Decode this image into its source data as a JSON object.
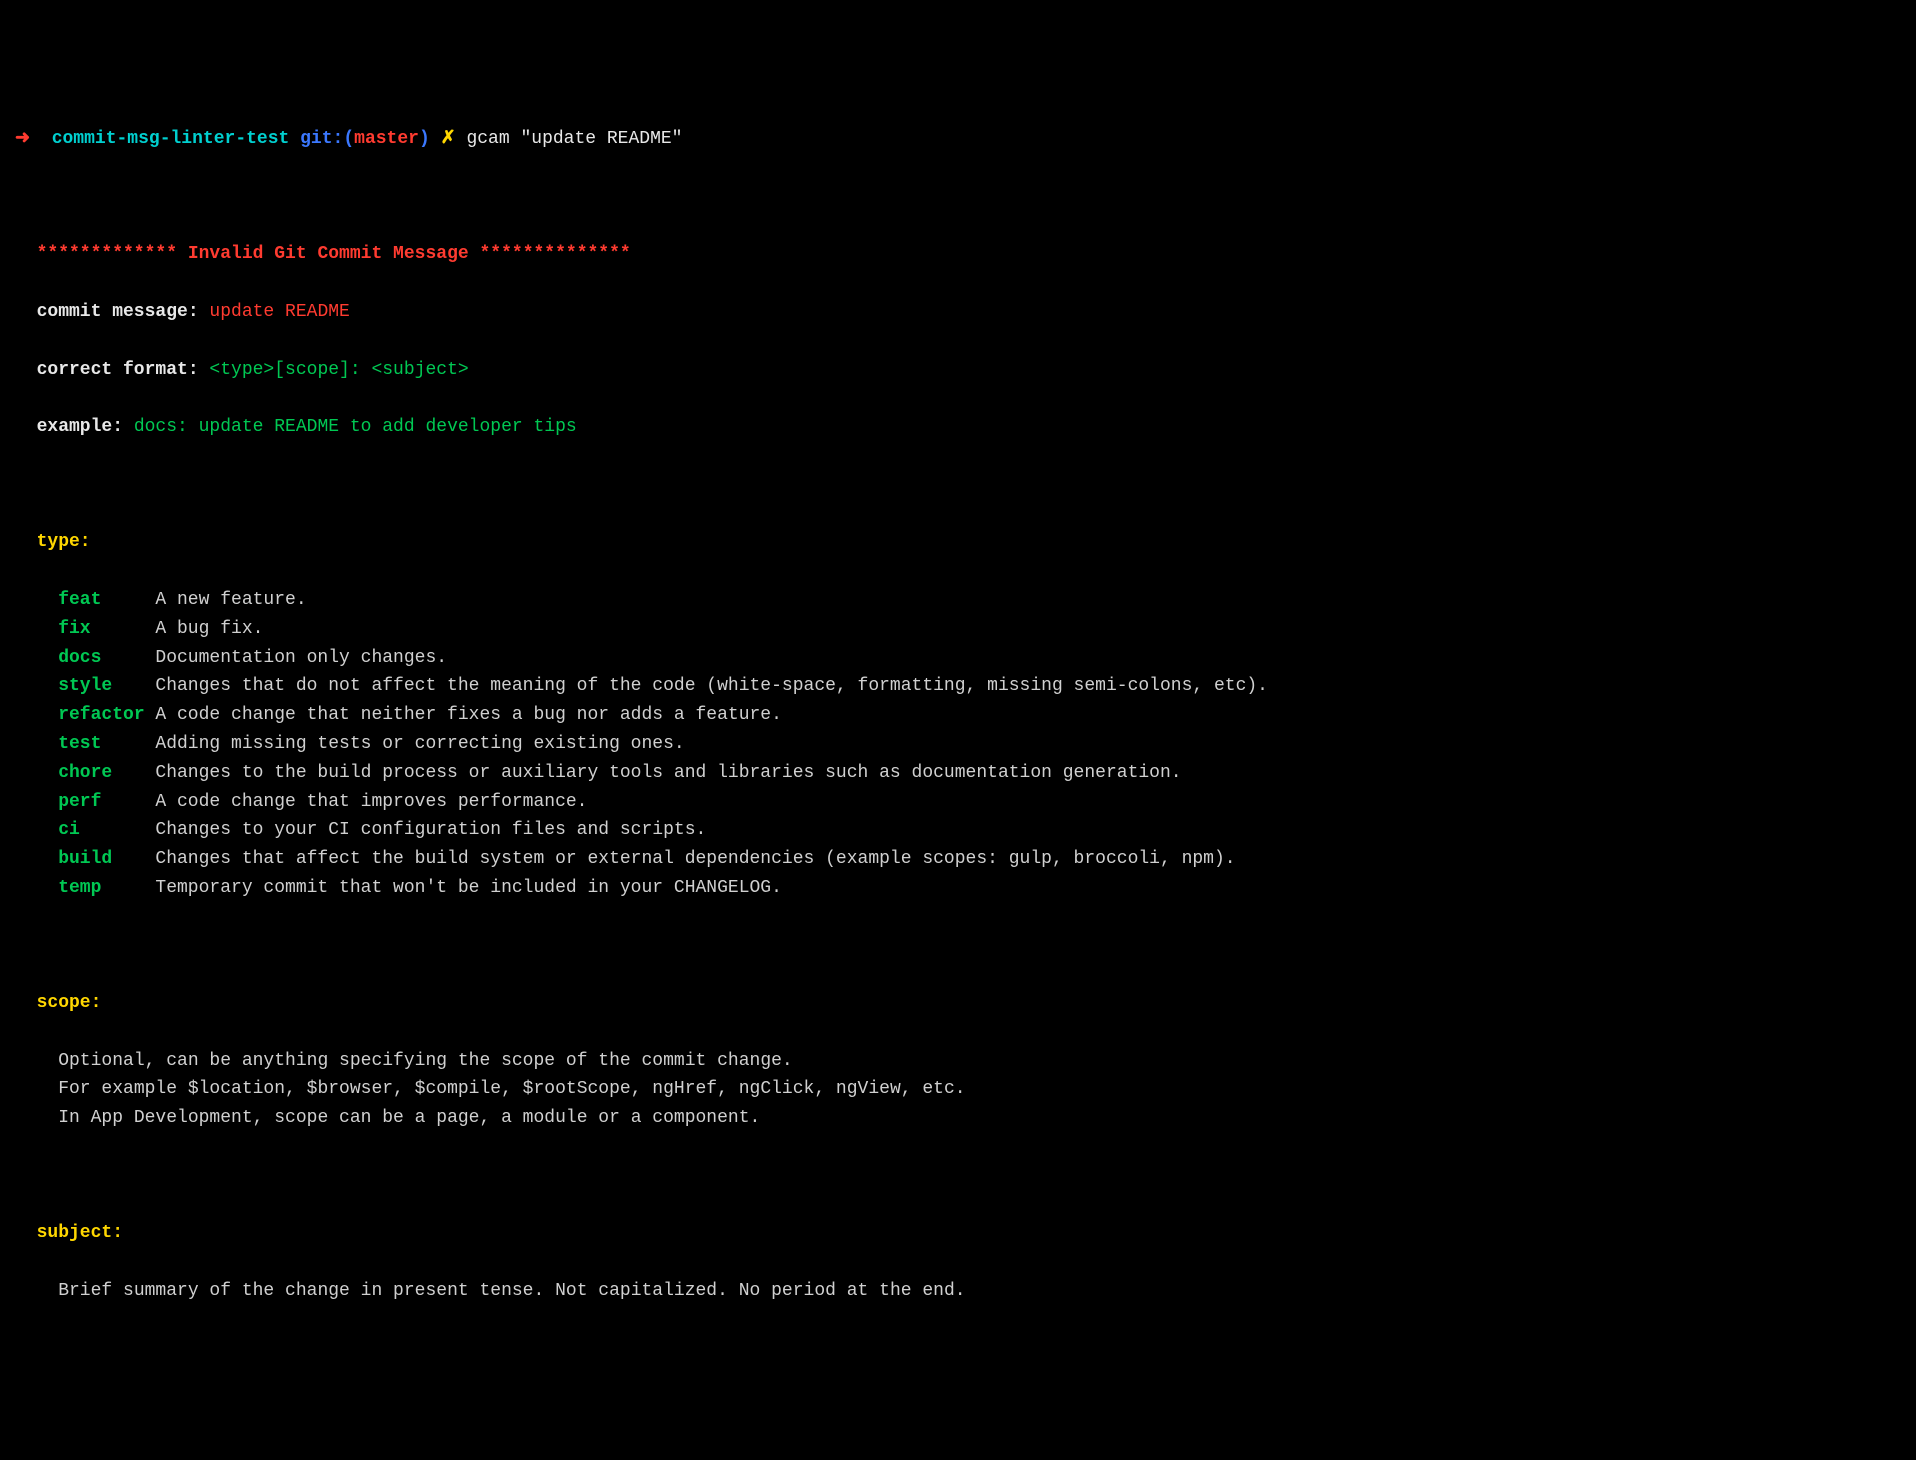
{
  "prompt": {
    "arrow": "➜  ",
    "dir": "commit-msg-linter-test",
    "git_label": " git:(",
    "branch": "master",
    "git_close": ")",
    "dirty": " ✗ ",
    "command": "gcam \"update README\""
  },
  "error": {
    "prefix": "************* ",
    "title": "Invalid Git Commit Message",
    "suffix": " **************"
  },
  "msg": {
    "label": "commit message:",
    "value": " update README"
  },
  "format": {
    "label": "correct format:",
    "value": " <type>[scope]: <subject>"
  },
  "example": {
    "label": "example:",
    "value": " docs: update README to add developer tips"
  },
  "type_header": "type:",
  "types": [
    {
      "key": "feat",
      "desc": "A new feature."
    },
    {
      "key": "fix",
      "desc": "A bug fix."
    },
    {
      "key": "docs",
      "desc": "Documentation only changes."
    },
    {
      "key": "style",
      "desc": "Changes that do not affect the meaning of the code (white-space, formatting, missing semi-colons, etc)."
    },
    {
      "key": "refactor",
      "desc": "A code change that neither fixes a bug nor adds a feature."
    },
    {
      "key": "test",
      "desc": "Adding missing tests or correcting existing ones."
    },
    {
      "key": "chore",
      "desc": "Changes to the build process or auxiliary tools and libraries such as documentation generation."
    },
    {
      "key": "perf",
      "desc": "A code change that improves performance."
    },
    {
      "key": "ci",
      "desc": "Changes to your CI configuration files and scripts."
    },
    {
      "key": "build",
      "desc": "Changes that affect the build system or external dependencies (example scopes: gulp, broccoli, npm)."
    },
    {
      "key": "temp",
      "desc": "Temporary commit that won't be included in your CHANGELOG."
    }
  ],
  "scope": {
    "header": "scope:",
    "lines": [
      "Optional, can be anything specifying the scope of the commit change.",
      "For example $location, $browser, $compile, $rootScope, ngHref, ngClick, ngView, etc.",
      "In App Development, scope can be a page, a module or a component."
    ]
  },
  "subject": {
    "header": "subject:",
    "lines": [
      "Brief summary of the change in present tense. Not capitalized. No period at the end."
    ]
  }
}
